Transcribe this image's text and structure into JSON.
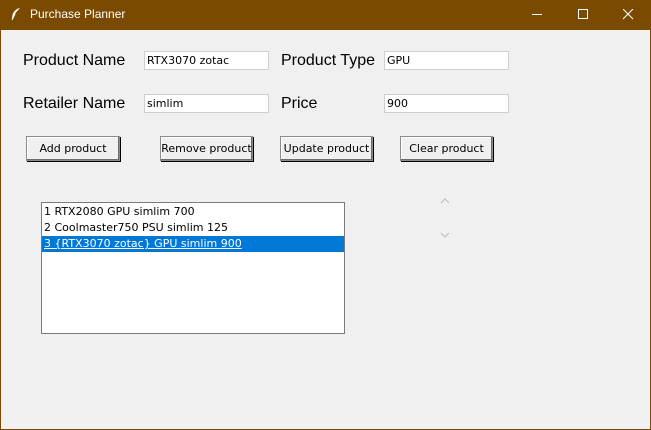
{
  "window": {
    "title": "Purchase Planner",
    "icon": "feather-icon",
    "controls": [
      "minimize-icon",
      "maximize-icon",
      "close-icon"
    ],
    "title_bar_color": "#7a4a00",
    "background_color": "#f0f0f0"
  },
  "form": {
    "product_name": {
      "label": "Product Name",
      "value": "RTX3070 zotac"
    },
    "product_type": {
      "label": "Product Type",
      "value": "GPU"
    },
    "retailer_name": {
      "label": "Retailer Name",
      "value": "simlim"
    },
    "price": {
      "label": "Price",
      "value": "900"
    }
  },
  "buttons": {
    "add": "Add product",
    "remove": "Remove product",
    "update": "Update product",
    "clear": "Clear product"
  },
  "list": {
    "items": [
      "1 RTX2080 GPU simlim 700",
      "2 Coolmaster750 PSU simlim 125",
      "3 {RTX3070 zotac} GPU simlim 900"
    ],
    "selected_index": 2,
    "selection_color": "#0078d7"
  },
  "scrollbar": {
    "up_icon": "chevron-up-icon",
    "down_icon": "chevron-down-icon"
  }
}
